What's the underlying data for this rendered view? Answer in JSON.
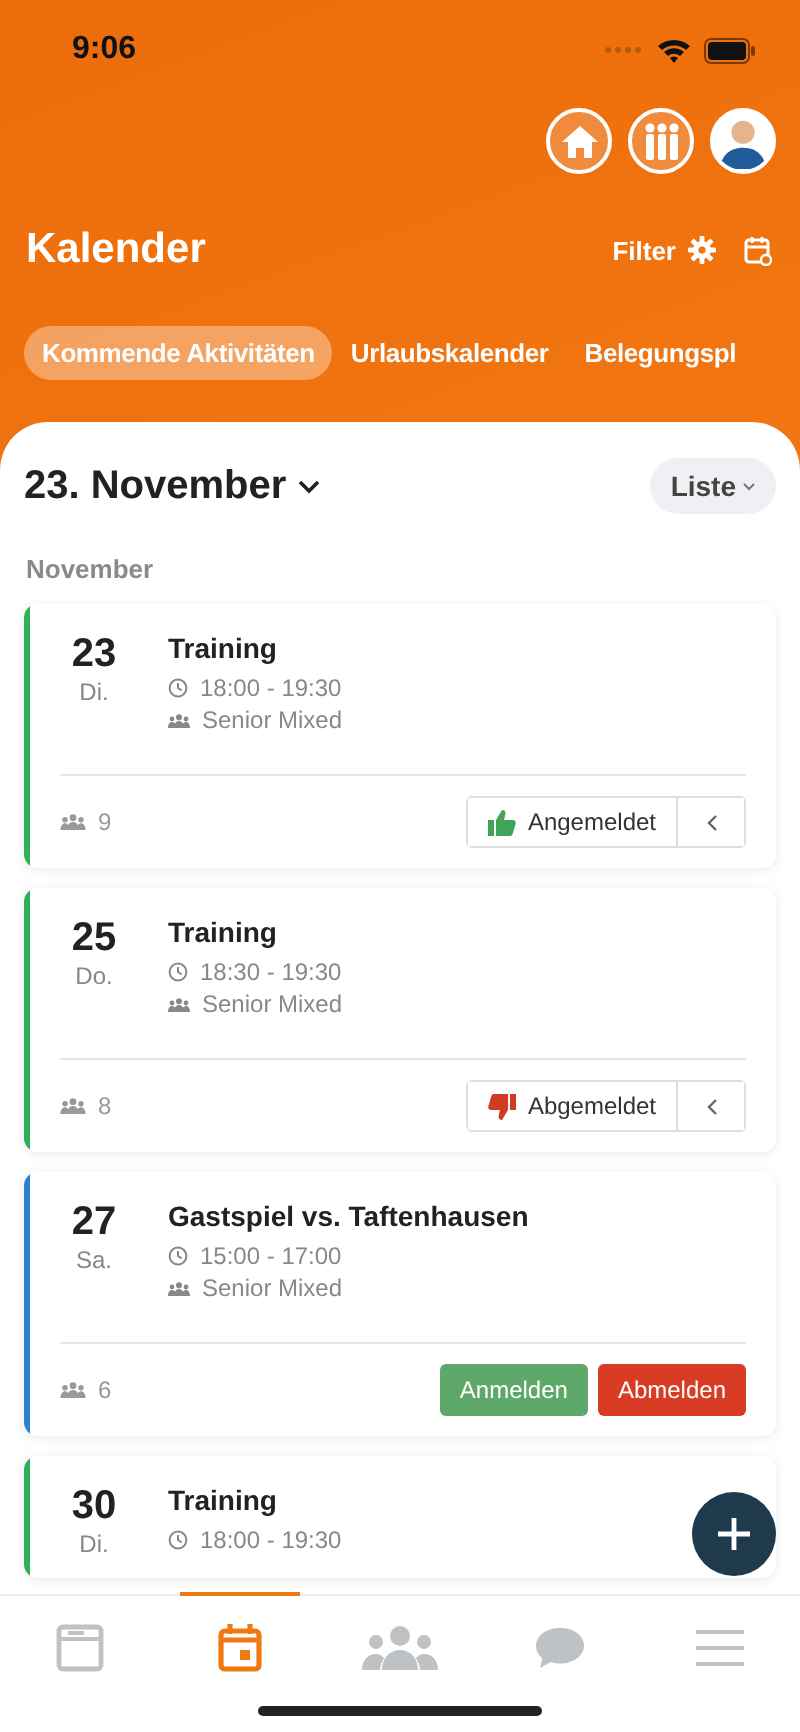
{
  "status_bar": {
    "time": "9:06"
  },
  "header": {
    "title": "Kalender",
    "filter_label": "Filter"
  },
  "tabs": [
    {
      "label": "Kommende Aktivitäten",
      "selected": true
    },
    {
      "label": "Urlaubskalender",
      "selected": false
    },
    {
      "label": "Belegungspl",
      "selected": false
    }
  ],
  "date_picker": {
    "label": "23. November"
  },
  "view_select": {
    "label": "Liste"
  },
  "section_header": "November",
  "events": [
    {
      "day": "23",
      "weekday": "Di.",
      "title": "Training",
      "time": "18:00 - 19:30",
      "group": "Senior Mixed",
      "participants": "9",
      "color": "#2eaf5a",
      "kind": "accepted",
      "response_label": "Angemeldet"
    },
    {
      "day": "25",
      "weekday": "Do.",
      "title": "Training",
      "time": "18:30 - 19:30",
      "group": "Senior Mixed",
      "participants": "8",
      "color": "#2eaf5a",
      "kind": "declined",
      "response_label": "Abgemeldet"
    },
    {
      "day": "27",
      "weekday": "Sa.",
      "title": "Gastspiel vs. Taftenhausen",
      "time": "15:00 - 17:00",
      "group": "Senior Mixed",
      "participants": "6",
      "color": "#2a7fd0",
      "kind": "open",
      "accept_label": "Anmelden",
      "decline_label": "Abmelden"
    },
    {
      "day": "30",
      "weekday": "Di.",
      "title": "Training",
      "time": "18:00 - 19:30",
      "color": "#2eaf5a"
    }
  ],
  "bottom_nav": [
    {
      "kind": "news",
      "selected": false
    },
    {
      "kind": "calendar",
      "selected": true
    },
    {
      "kind": "members",
      "selected": false
    },
    {
      "kind": "chat",
      "selected": false
    },
    {
      "kind": "menu",
      "selected": false
    }
  ]
}
